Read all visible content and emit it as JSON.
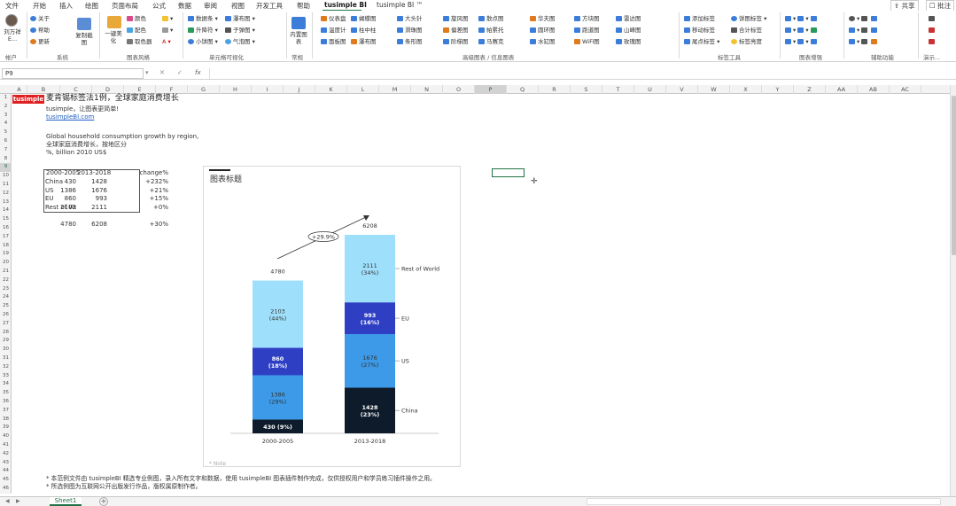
{
  "menu": {
    "items": [
      "文件",
      "开始",
      "插入",
      "绘图",
      "页面布局",
      "公式",
      "数据",
      "审阅",
      "视图",
      "开发工具",
      "帮助",
      "tusimple BI",
      "tusimple BI ™"
    ],
    "active_index": 11,
    "share_label": "共享",
    "comment_label": "批注"
  },
  "ribbon": {
    "account": {
      "name": "刘万祥 E...",
      "group": "帐户"
    },
    "system": {
      "items": [
        "关于",
        "帮助",
        "更新"
      ],
      "big": "复制截图",
      "group": "系统"
    },
    "style": {
      "big": "一键美化",
      "items": [
        "颜色",
        "配色",
        "取色器"
      ],
      "group": "图表风格"
    },
    "cell_vis": {
      "items": [
        "数据条",
        "升降符",
        "小饼图",
        "瀑布图",
        "子弹图",
        "气泡图"
      ],
      "group": "单元格可视化"
    },
    "common": {
      "big": "内置图表",
      "group": "常规"
    },
    "advanced": {
      "items": [
        "仪表盘",
        "温度计",
        "面板图",
        "蝴蝶图",
        "柱中柱",
        "瀑布图",
        "大头针",
        "滑珠图",
        "条形图",
        "旋风图",
        "偏差图",
        "阶梯图",
        "散点图",
        "帕累托",
        "马赛克",
        "华夫图",
        "圆环图",
        "水缸图",
        "方块图",
        "跑道图",
        "WiFi图",
        "雷达图",
        "山峰图",
        "玫瑰图"
      ],
      "group": "高级图表 / 信息图表"
    },
    "label_tools": {
      "items": [
        "添加标签",
        "移动标签",
        "尾点标签",
        "饼图标签",
        "合计标签",
        "标签亮度"
      ],
      "group": "标签工具"
    },
    "enhance": {
      "group": "图表增强"
    },
    "assist": {
      "group": "辅助功能"
    },
    "demo": {
      "group": "演示..."
    }
  },
  "formula_bar": {
    "name_box": "P9",
    "fx": "fx",
    "formula": ""
  },
  "columns": [
    "A",
    "B",
    "C",
    "D",
    "E",
    "F",
    "G",
    "H",
    "I",
    "J",
    "K",
    "L",
    "M",
    "N",
    "O",
    "P",
    "Q",
    "R",
    "S",
    "T",
    "U",
    "V",
    "W",
    "X",
    "Y",
    "Z",
    "AA",
    "AB",
    "AC"
  ],
  "rows_count": 46,
  "sheet": {
    "logo": "tusimple",
    "title": "麦肯锡标签法1例，全球家庭消费增长",
    "subtitle": "tusimple，让图表更简单!",
    "link": "tusimpleBI.com",
    "desc1": "Global household consumption growth by region,",
    "desc2": "全球家庭消费增长，按地区分",
    "desc3": "%, billion 2010 US$",
    "table": {
      "headers": [
        "",
        "2000-2005",
        "2013-2018",
        "change%"
      ],
      "rows": [
        [
          "China",
          "430",
          "1428",
          "+232%"
        ],
        [
          "US",
          "1386",
          "1676",
          "+21%"
        ],
        [
          "EU",
          "860",
          "993",
          "+15%"
        ],
        [
          "Rest of Wo",
          "2103",
          "2111",
          "+0%"
        ]
      ],
      "totals": [
        "",
        "4780",
        "6208",
        "+30%"
      ]
    },
    "footnote1": "* 本范例文件由 tusimpleBI 精选专业例图，录入所有文字和数据，使用 tusimpleBI 图表插件制作完成，仅供授权用户和学员练习插件操作之用。",
    "footnote2": "* 所选例图为互联网公开出版发行作品，版权属原制作者。"
  },
  "chart_data": {
    "type": "bar",
    "stacked": true,
    "title": "图表标题",
    "categories": [
      "2000-2005",
      "2013-2018"
    ],
    "totals": [
      4780,
      6208
    ],
    "growth_label": "+29.9%",
    "series": [
      {
        "name": "China",
        "values": [
          430,
          1428
        ],
        "pct": [
          "9%",
          "23%"
        ],
        "color": "#0d1b2a"
      },
      {
        "name": "US",
        "values": [
          1386,
          1676
        ],
        "pct": [
          "29%",
          "27%"
        ],
        "color": "#3c9ae8"
      },
      {
        "name": "EU",
        "values": [
          860,
          993
        ],
        "pct": [
          "18%",
          "16%"
        ],
        "color": "#2e3fc4"
      },
      {
        "name": "Rest of World",
        "values": [
          2103,
          2111
        ],
        "pct": [
          "44%",
          "34%"
        ],
        "color": "#9ee0fb"
      }
    ],
    "bar_labels": [
      [
        "430 (9%)",
        "1386\n(29%)",
        "860\n(18%)",
        "2103\n(44%)"
      ],
      [
        "1428\n(23%)",
        "1676\n(27%)",
        "993\n(16%)",
        "2111\n(34%)"
      ]
    ],
    "ylim": [
      0,
      7000
    ],
    "note": "* Note"
  },
  "tabs": {
    "sheet": "Sheet1",
    "add": "+"
  }
}
